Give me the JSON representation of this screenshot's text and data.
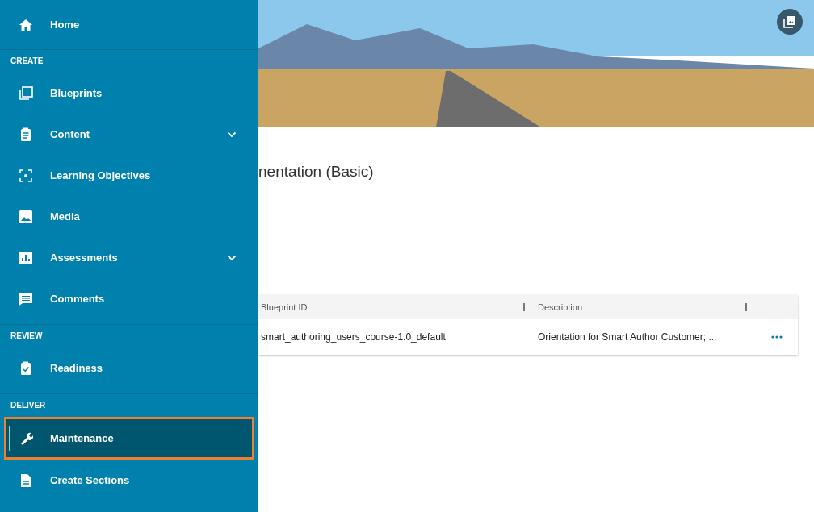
{
  "nav": {
    "home": {
      "label": "Home",
      "selected": false
    },
    "sections": [
      {
        "title": "CREATE",
        "items": [
          {
            "label": "Blueprints",
            "expandable": false,
            "selected": false
          },
          {
            "label": "Content",
            "expandable": true,
            "selected": false
          },
          {
            "label": "Learning Objectives",
            "expandable": false,
            "selected": false
          },
          {
            "label": "Media",
            "expandable": false,
            "selected": false
          },
          {
            "label": "Assessments",
            "expandable": true,
            "selected": false
          },
          {
            "label": "Comments",
            "expandable": false,
            "selected": false
          }
        ]
      },
      {
        "title": "REVIEW",
        "items": [
          {
            "label": "Readiness",
            "expandable": false,
            "selected": false
          }
        ]
      },
      {
        "title": "DELIVER",
        "items": [
          {
            "label": "Maintenance",
            "expandable": false,
            "selected": true
          },
          {
            "label": "Create Sections",
            "expandable": false,
            "selected": false
          }
        ]
      }
    ]
  },
  "page": {
    "title": "nentation (Basic)",
    "table": {
      "columns": [
        "Blueprint ID",
        "Description"
      ],
      "rows": [
        {
          "cells": [
            "smart_authoring_users_course-1.0_default",
            "Orientation for Smart Author Customer; ..."
          ]
        }
      ]
    }
  }
}
